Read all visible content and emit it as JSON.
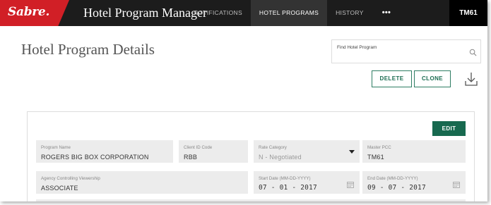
{
  "brand": {
    "logo": "Sabre.",
    "app_title": "Hotel Program Manager",
    "accent": "#d11f26",
    "primary": "#17694f"
  },
  "nav": {
    "items": [
      {
        "label": "NOTIFICATIONS",
        "active": false
      },
      {
        "label": "HOTEL PROGRAMS",
        "active": true
      },
      {
        "label": "HISTORY",
        "active": false
      }
    ],
    "more_label": "•••",
    "user": "TM61"
  },
  "header": {
    "title": "Hotel Program Details",
    "search": {
      "placeholder": "Find Hotel Program",
      "icon": "search-icon"
    },
    "delete_label": "DELETE",
    "clone_label": "CLONE",
    "download_icon": "download-icon"
  },
  "card": {
    "edit_label": "EDIT",
    "fields": {
      "program_name": {
        "label": "Program Name",
        "value": "ROGERS BIG BOX CORPORATION"
      },
      "client_id": {
        "label": "Client ID Code",
        "value": "RBB"
      },
      "rate_category": {
        "label": "Rate Category",
        "value": "N - Negotiated"
      },
      "master_pcc": {
        "label": "Master PCC",
        "value": "TM61"
      },
      "agency_viewership": {
        "label": "Agency Controlling Viewership",
        "value": "ASSOCIATE"
      },
      "start_date": {
        "label": "Start Date (MM-DD-YYYY)",
        "value": "07 - 01 - 2017"
      },
      "end_date": {
        "label": "End Date (MM-DD-YYYY)",
        "value": "09 - 07 - 2017"
      }
    }
  }
}
